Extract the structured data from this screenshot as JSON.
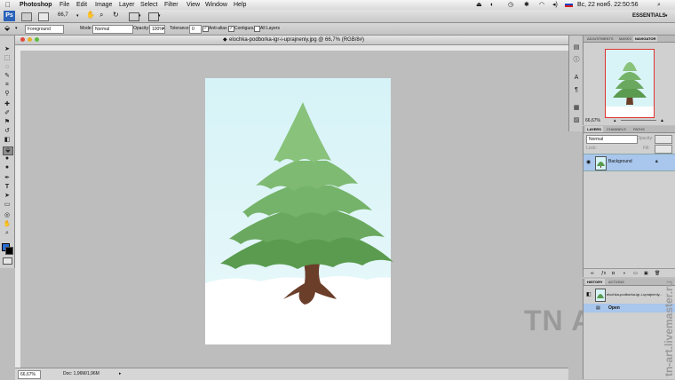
{
  "menubar": {
    "apple": "",
    "app": "Photoshop",
    "items": [
      "File",
      "Edit",
      "Image",
      "Layer",
      "Select",
      "Filter",
      "View",
      "Window",
      "Help"
    ],
    "flag": "RU",
    "clock": "Вс, 22 нояб. 22:50:56"
  },
  "optionsbar": {
    "zoom": "66,7",
    "workspace": "ESSENTIALS"
  },
  "fillbar": {
    "source": "Foreground",
    "mode_label": "Mode:",
    "mode_value": "Normal",
    "opacity_label": "Opacity:",
    "opacity_value": "100%",
    "tolerance_label": "Tolerance:",
    "tolerance_value": "0",
    "anti_alias": "Anti-alias",
    "contiguous": "Contiguous",
    "all_layers": "All Layers"
  },
  "document": {
    "title": "elochka-podborka-igr-i-uprajneniy.jpg @ 66,7% (RGB/8#)",
    "zoom": "66,67%",
    "doc_info": "Doc: 1,96M/1,96M"
  },
  "navigator": {
    "tabs": [
      "ADJUSTMENTS",
      "MASKS",
      "NAVIGATOR"
    ],
    "zoom": "66,67%"
  },
  "layers": {
    "tabs": [
      "LAYERS",
      "CHANNELS",
      "PATHS"
    ],
    "blend_mode": "Normal",
    "opacity_label": "Opacity:",
    "lock_label": "Lock:",
    "fill_label": "Fill:",
    "layer_name": "Background"
  },
  "history": {
    "tabs": [
      "HISTORY",
      "ACTIONS"
    ],
    "snapshot": "elochka-podborka-igr-i-uprajneniy...",
    "state": "Open"
  },
  "watermark": {
    "logo": "TN ART",
    "url": "tn-art.livemaster.ru"
  }
}
